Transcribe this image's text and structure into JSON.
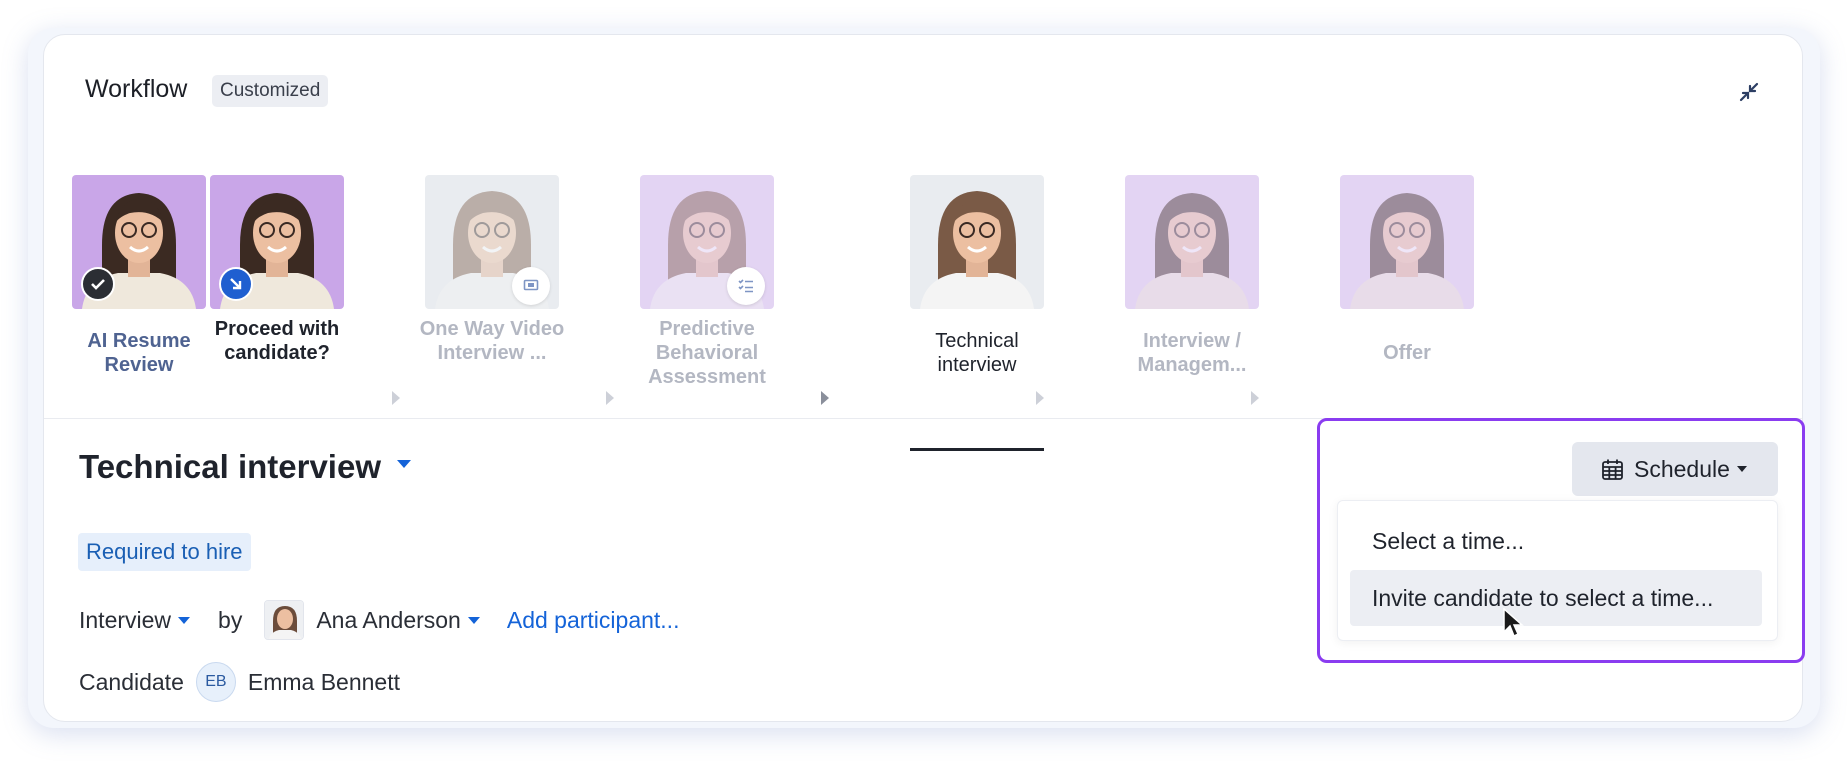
{
  "header": {
    "title": "Workflow",
    "badge": "Customized",
    "collapse_icon": "collapse-arrows-icon"
  },
  "stages": [
    {
      "label": "AI Resume Review",
      "state": "completed",
      "status_icon": "check-icon"
    },
    {
      "label": "Proceed with candidate?",
      "state": "current-decision",
      "status_icon": "arrow-down-right-icon"
    },
    {
      "label": "One Way Video Interview ...",
      "state": "upcoming",
      "type_icon": "video-screen-icon"
    },
    {
      "label": "Predictive Behavioral Assessment",
      "state": "upcoming",
      "type_icon": "checklist-icon"
    },
    {
      "label": "Technical interview",
      "state": "active"
    },
    {
      "label": "Interview / Managem...",
      "state": "upcoming"
    },
    {
      "label": "Offer",
      "state": "upcoming"
    }
  ],
  "main": {
    "title": "Technical interview",
    "required_badge": "Required to hire",
    "interview_type": "Interview",
    "by_label": "by",
    "interviewer_name": "Ana Anderson",
    "add_participant": "Add participant...",
    "candidate_label": "Candidate",
    "candidate_initials": "EB",
    "candidate_name": "Emma Bennett"
  },
  "schedule": {
    "button_label": "Schedule",
    "menu_items": [
      "Select a time...",
      "Invite candidate to select a time..."
    ]
  },
  "colors": {
    "accent_purple": "#8a3cf0",
    "link_blue": "#1463d8",
    "stage_bg_purple": "#c9a6e8",
    "stage_bg_light": "#e3d4f3"
  }
}
